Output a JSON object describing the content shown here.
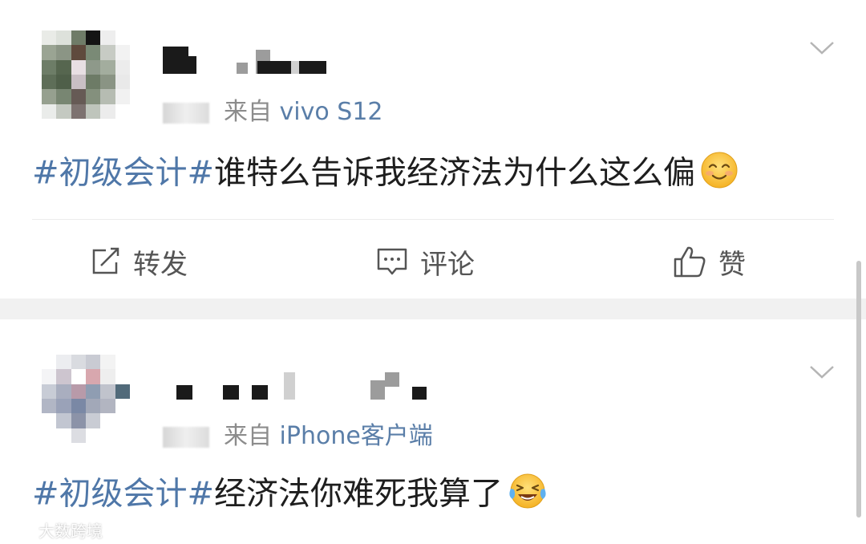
{
  "posts": [
    {
      "source_prefix": "来自",
      "source_device": "vivo S12",
      "hashtag": "#初级会计#",
      "text": "谁特么告诉我经济法为什么这么偏",
      "emoji": "smiling-face-icon",
      "actions": {
        "repost": "转发",
        "comment": "评论",
        "like": "赞"
      }
    },
    {
      "source_prefix": "来自",
      "source_device": "iPhone客户端",
      "hashtag": "#初级会计#",
      "text": "经济法你难死我算了",
      "emoji": "laughing-crying-face-icon"
    }
  ],
  "watermark": "大数跨境",
  "colors": {
    "link": "#4f77a8",
    "meta": "#8c8c8c",
    "separator": "#f1f1f1"
  }
}
